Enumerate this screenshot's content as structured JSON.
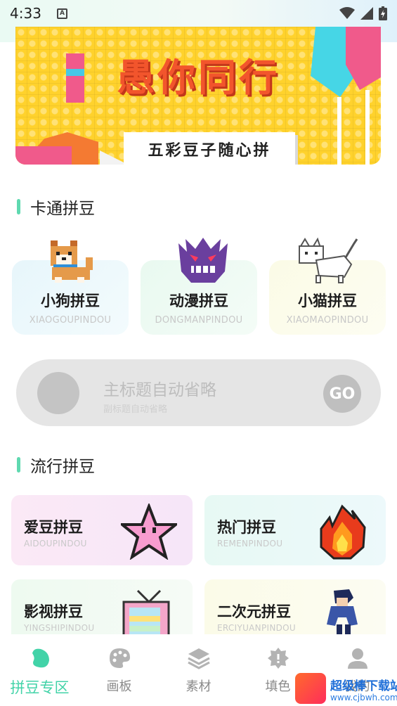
{
  "status_bar": {
    "time": "4:33",
    "notification_letter": "A"
  },
  "banner": {
    "title": "愚你同行",
    "subtitle": "五彩豆子随心拼"
  },
  "section_cartoon": {
    "title": "卡通拼豆",
    "cards": [
      {
        "title": "小狗拼豆",
        "subtitle": "XIAOGOUPINDOU",
        "icon": "pixel-dog-icon"
      },
      {
        "title": "动漫拼豆",
        "subtitle": "DONGMANPINDOU",
        "icon": "pixel-ghost-icon"
      },
      {
        "title": "小猫拼豆",
        "subtitle": "XIAOMAOPINDOU",
        "icon": "pixel-cat-icon"
      }
    ]
  },
  "promo": {
    "title": "主标题自动省略",
    "subtitle": "副标题自动省略",
    "go_label": "GO"
  },
  "section_popular": {
    "title": "流行拼豆",
    "cards": [
      {
        "title": "爱豆拼豆",
        "subtitle": "AIDOUPINDOU",
        "icon": "pixel-star-icon"
      },
      {
        "title": "热门拼豆",
        "subtitle": "REMENPINDOU",
        "icon": "pixel-fire-icon"
      },
      {
        "title": "影视拼豆",
        "subtitle": "YINGSHIPINDOU",
        "icon": "pixel-tv-icon"
      },
      {
        "title": "二次元拼豆",
        "subtitle": "ERCIYUANPINDOU",
        "icon": "pixel-ninja-icon"
      }
    ]
  },
  "bottom_nav": [
    {
      "label": "拼豆专区",
      "active": true,
      "icon": "bean-icon"
    },
    {
      "label": "画板",
      "active": false,
      "icon": "palette-icon"
    },
    {
      "label": "素材",
      "active": false,
      "icon": "layers-icon"
    },
    {
      "label": "填色",
      "active": false,
      "icon": "gear-icon"
    },
    {
      "label": "我的",
      "active": false,
      "icon": "person-icon"
    }
  ],
  "watermark": {
    "line1": "超级棒下载站",
    "line2": "www.cjbwh.com"
  },
  "colors": {
    "accent": "#42d3a8",
    "section_bar": "#5fd9b0",
    "banner_bg": "#ffd22c",
    "banner_title": "#f2552c"
  }
}
